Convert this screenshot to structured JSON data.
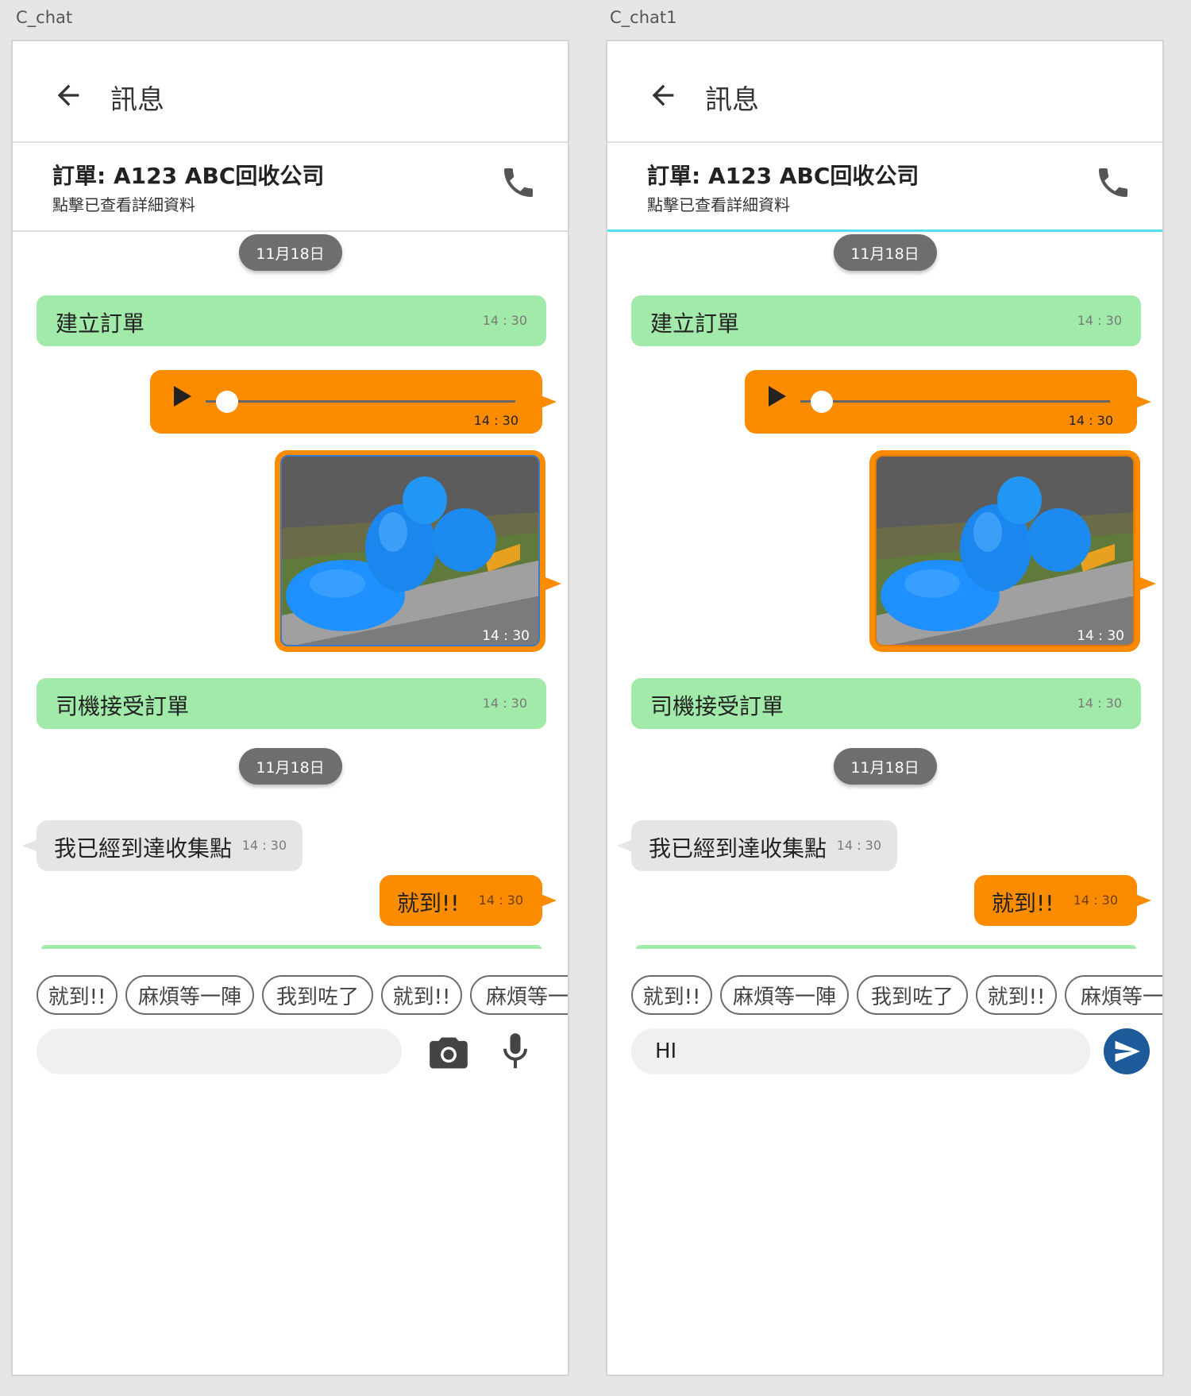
{
  "screens": [
    {
      "artboard": "C_chat",
      "header_title": "訊息",
      "order_title": "訂單: A123 ABC回收公司",
      "order_subtitle": "點擊已查看詳細資料",
      "date1": "11月18日",
      "sys1_text": "建立訂單",
      "sys1_time": "14 : 30",
      "audio_time": "14 : 30",
      "audio_progress": 0.07,
      "image_time": "14 : 30",
      "sys2_text": "司機接受訂單",
      "sys2_time": "14 : 30",
      "date2": "11月18日",
      "in_text": "我已經到達收集點",
      "in_time": "14 : 30",
      "out_text": "就到!!",
      "out_time": "14 : 30",
      "chips": [
        "就到!!",
        "麻煩等一陣",
        "我到咗了",
        "就到!!",
        "麻煩等一陣"
      ],
      "input_value": ""
    },
    {
      "artboard": "C_chat1",
      "header_title": "訊息",
      "order_title": "訂單: A123 ABC回收公司",
      "order_subtitle": "點擊已查看詳細資料",
      "date1": "11月18日",
      "sys1_text": "建立訂單",
      "sys1_time": "14 : 30",
      "audio_time": "14 : 30",
      "audio_progress": 0.07,
      "image_time": "14 : 30",
      "sys2_text": "司機接受訂單",
      "sys2_time": "14 : 30",
      "date2": "11月18日",
      "in_text": "我已經到達收集點",
      "in_time": "14 : 30",
      "out_text": "就到!!",
      "out_time": "14 : 30",
      "chips": [
        "就到!!",
        "麻煩等一陣",
        "我到咗了",
        "就到!!",
        "麻煩等一陣"
      ],
      "input_value": "HI"
    }
  ],
  "colors": {
    "system_bubble": "#a1eaa9",
    "outgoing_bubble": "#fb8c00",
    "incoming_bubble": "#e5e5e5",
    "date_pill": "#6e6e6e",
    "send_button": "#1d5a9a",
    "active_underline": "#55e0f0"
  },
  "icons": [
    "arrow-left-icon",
    "phone-icon",
    "play-icon",
    "camera-icon",
    "mic-icon",
    "send-icon"
  ]
}
